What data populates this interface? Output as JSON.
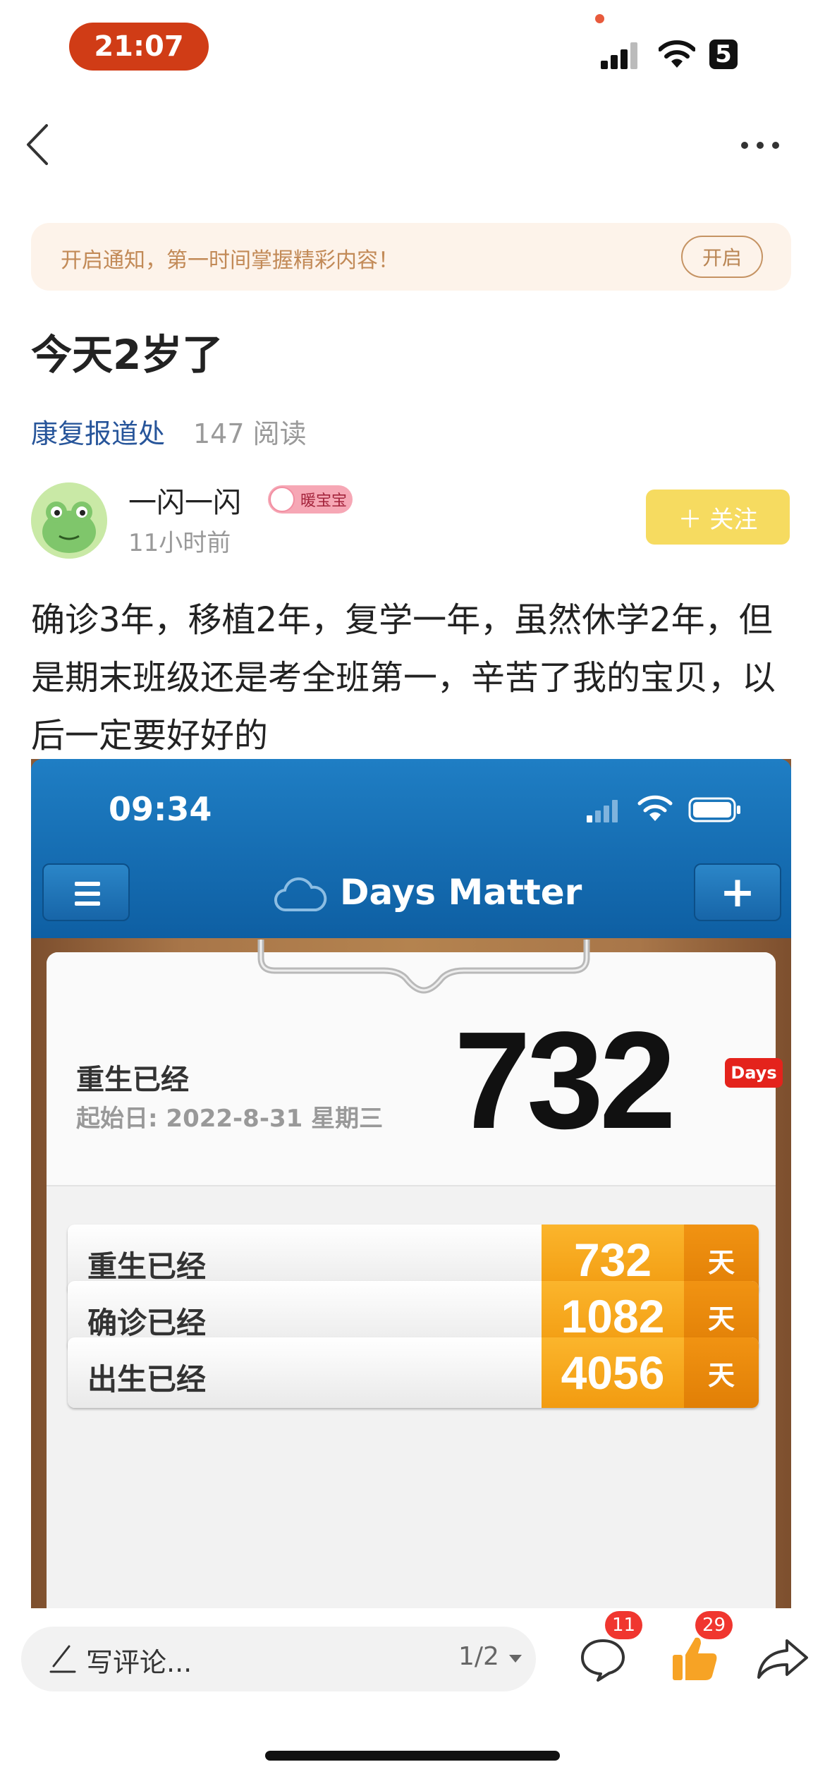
{
  "status_bar": {
    "time": "21:07",
    "battery": "5"
  },
  "notice": {
    "text": "开启通知，第一时间掌握精彩内容！",
    "button": "开启"
  },
  "post": {
    "title": "今天2岁了",
    "channel": "康复报道处",
    "reads": "147 阅读",
    "author": "一闪一闪",
    "badge": "暖宝宝",
    "time": "11小时前",
    "follow": "＋ 关注",
    "body": "确诊3年，移植2年，复学一年，虽然休学2年，但是期末班级还是考全班第一，辛苦了我的宝贝，以后一定要好好的"
  },
  "screenshot": {
    "time": "09:34",
    "app_title": "Days Matter",
    "hero": {
      "label": "重生已经",
      "sub": "起始日: 2022-8-31 星期三",
      "value": "732",
      "unit": "Days"
    },
    "rows": [
      {
        "label": "重生已经",
        "value": "732",
        "unit": "天"
      },
      {
        "label": "确诊已经",
        "value": "1082",
        "unit": "天"
      },
      {
        "label": "出生已经",
        "value": "4056",
        "unit": "天"
      }
    ]
  },
  "bottom_bar": {
    "comment_placeholder": "写评论...",
    "page": "1/2",
    "comment_count": "11",
    "like_count": "29"
  },
  "colors": {
    "accent_red": "#d03c16",
    "link_blue": "#27559a",
    "follow_yellow": "#f6db60",
    "app_blue": "#1672b8",
    "day_orange": "#f6a51e"
  },
  "icons": [
    "back-icon",
    "more-icon",
    "signal-icon",
    "wifi-icon",
    "battery-icon",
    "cloud-icon",
    "menu-icon",
    "plus-icon",
    "pencil-icon",
    "comment-icon",
    "like-icon",
    "share-icon"
  ]
}
